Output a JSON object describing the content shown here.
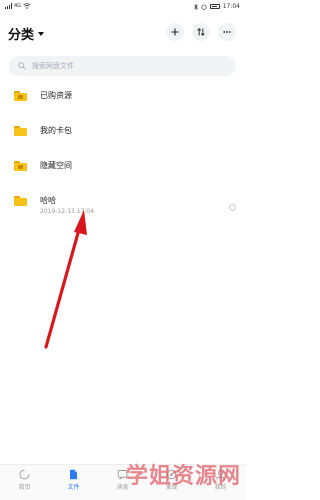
{
  "status_bar": {
    "time": "17:04",
    "network_label": "4G"
  },
  "header": {
    "title": "分类"
  },
  "search": {
    "placeholder": "搜索网盘文件"
  },
  "folders": [
    {
      "name": "已购资源",
      "meta": ""
    },
    {
      "name": "我的卡包",
      "meta": ""
    },
    {
      "name": "隐藏空间",
      "meta": ""
    },
    {
      "name": "哈哈",
      "meta": "2019-12-13  17:04"
    }
  ],
  "tabs": [
    {
      "label": "首页",
      "icon": "home-icon"
    },
    {
      "label": "文件",
      "icon": "file-icon"
    },
    {
      "label": "消息",
      "icon": "message-icon"
    },
    {
      "label": "发现",
      "icon": "discover-icon"
    },
    {
      "label": "我的",
      "icon": "profile-icon"
    }
  ],
  "watermark": {
    "text": "学姐资源网"
  },
  "colors": {
    "accent": "#2d7af6",
    "folder": "#f7c21a",
    "arrow": "#d8161b",
    "watermark": "#de5a64"
  }
}
